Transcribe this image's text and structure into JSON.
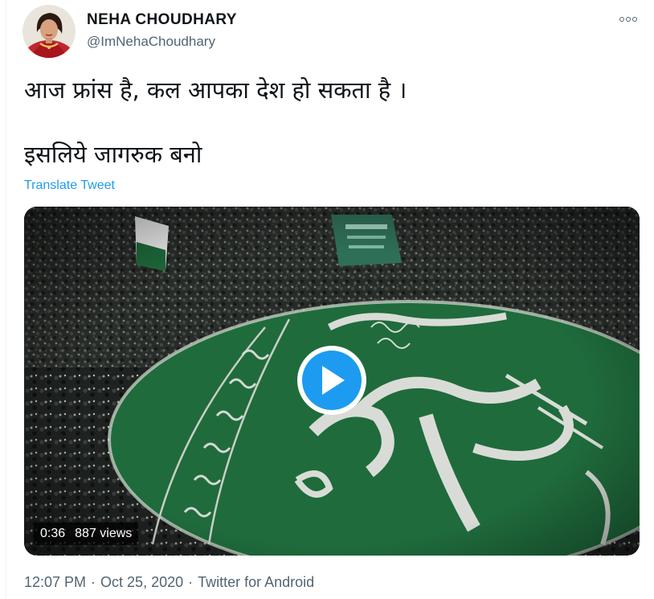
{
  "author": {
    "display_name": "NEHA CHOUDHARY",
    "handle": "@ImNehaChoudhary"
  },
  "tweet": {
    "line1": "आज फ्रांस है, कल आपका देश हो सकता है ।",
    "line2": "इसलिये जागरुक बनो",
    "translate_label": "Translate Tweet"
  },
  "video": {
    "duration": "0:36",
    "views": "887 views"
  },
  "meta": {
    "time": "12:07 PM",
    "date": "Oct 25, 2020",
    "separator": "·",
    "source": "Twitter for Android"
  },
  "colors": {
    "accent": "#1d9bf0",
    "secondary_text": "#536471",
    "primary_text": "#0f1419",
    "flag_green": "#1f6b3c"
  }
}
